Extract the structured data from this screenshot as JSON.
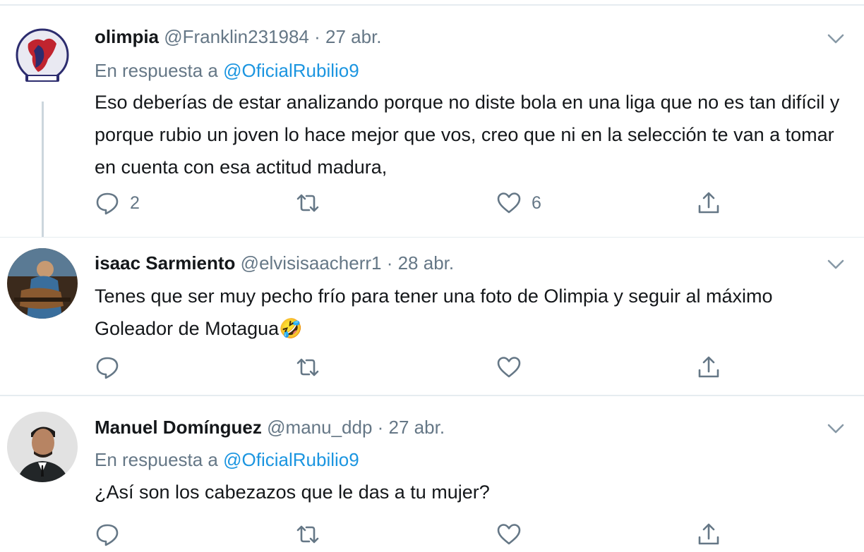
{
  "tweets": [
    {
      "name": "olimpia",
      "handle": "@Franklin231984",
      "date": "· 27 abr.",
      "reply_prefix": "En respuesta a",
      "reply_to": "@OficialRubilio9",
      "text": "Eso deberías de estar analizando porque no diste bola en una liga que no es tan difícil y porque rubio un joven lo hace mejor que vos, creo que ni en la selección te van a tomar en cuenta con esa actitud madura,",
      "replies": "2",
      "retweets": "",
      "likes": "6"
    },
    {
      "name": "isaac Sarmiento",
      "handle": "@elvisisaacherr1",
      "date": "· 28 abr.",
      "text": "Tenes que ser muy pecho frío para tener una foto de Olimpia y seguir al máximo Goleador de Motagua🤣",
      "replies": "",
      "retweets": "",
      "likes": ""
    },
    {
      "name": "Manuel Domínguez",
      "handle": "@manu_ddp",
      "date": "· 27 abr.",
      "reply_prefix": "En respuesta a",
      "reply_to": "@OficialRubilio9",
      "text": "¿Así son los cabezazos que le das a tu mujer?",
      "replies": "",
      "retweets": "",
      "likes": ""
    }
  ],
  "icons": {
    "reply": "reply-icon",
    "retweet": "retweet-icon",
    "like": "heart-icon",
    "share": "share-icon",
    "more": "chevron-down-icon"
  },
  "colors": {
    "text": "#14171a",
    "secondary": "#657786",
    "link": "#1b95e0",
    "divider": "#e6ecf0"
  }
}
